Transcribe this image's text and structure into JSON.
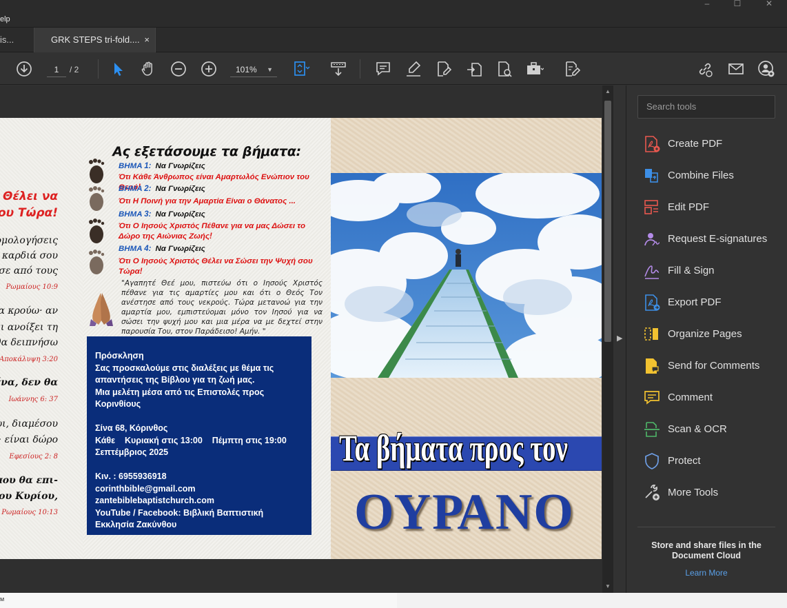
{
  "app": {
    "menu_help": "elp",
    "tabs": {
      "prev_tab": "is...",
      "active_tab": "GRK STEPS tri-fold....",
      "close": "×"
    }
  },
  "toolbar": {
    "page_current": "1",
    "page_total": "/ 2",
    "zoom": "101%",
    "icons": [
      "download-icon",
      "select-cursor-icon",
      "hand-icon",
      "zoom-out-icon",
      "zoom-in-icon",
      "fit-page-icon",
      "scroll-mode-icon",
      "comment-icon",
      "highlight-icon",
      "edit-icon",
      "export-icon",
      "organize-icon",
      "tools-bag-icon",
      "sign-icon",
      "link-icon",
      "mail-icon",
      "add-user-icon"
    ]
  },
  "document": {
    "left_column": {
      "red_heading_1": "ός Θέλει να",
      "red_heading_2": "ου Τώρα!",
      "lines_1": [
        "ομολογήσεις",
        "καρδιά σου",
        "σε από τους"
      ],
      "ref_1": "Ρωμαίους 10:9",
      "lines_2": [
        "α κρούω· αν",
        "αι ανοίξει τη",
        "θα δειπνήσω"
      ],
      "ref_2": "Αποκάλυψη 3:20",
      "lines_3": [
        "ένα, δεν θα"
      ],
      "ref_3": "Ιωάννης 6: 37",
      "lines_4": [
        "ωι, διαμέσου",
        "ς· είναι δώρο"
      ],
      "ref_4": "Εφεσίους 2: 8",
      "lines_5": [
        "ς που θα επι-",
        "α του Κυρίου,"
      ],
      "ref_5": "Ρωμαίους 10:13"
    },
    "middle_column": {
      "heading": "Ας εξετάσουμε τα βήματα:",
      "know": "Να Γνωρίζεις",
      "steps": [
        {
          "label": "ΒΗΜΑ 1:",
          "text": "Ότι Κάθε Άνθρωπος είναι Αμαρτωλός Ενώπιον του Θεού!"
        },
        {
          "label": "ΒΗΜΑ 2:",
          "text": "Ότι Η Ποινή  για την Αμαρτία Είναι ο Θάνατος ..."
        },
        {
          "label": "ΒΗΜΑ 3:",
          "text": "Ότι Ο Ιησούς Χριστός Πέθανε για να μας Δώσει το Δώρο της Αιώνιας Ζωής!"
        },
        {
          "label": "ΒΗΜΑ 4:",
          "text": "Ότι  Ο Ιησούς Χριστός Θέλει να  Σώσει  την Ψυχή σου Τώρα!"
        }
      ],
      "prayer": "\"Αγαπητέ Θεέ μου, πιστεύω ότι ο Ιησούς Χριστός πέθανε για τις αμαρτίες μου και ότι ο Θεός Τον ανέστησε από τους νεκρούς.  Τώρα μετανοώ για  την αμαρτία μου, εμπιστεύομαι μόνο τον Ιησού για να σώσει την ψυχή μου και μια μέρα να με δεχτεί στην παρουσία Του,  στον Παράδεισο!  Αμήν. \"",
      "invitation": {
        "title": "Πρόσκληση",
        "lines": [
          "Σας προσκαλούμε στις διαλέξεις με θέμα τις",
          "απαντήσεις της Βίβλου για τη ζωή μας.",
          "Μια μελέτη μέσα από τις Επιστολές προς",
          "Κορινθίους"
        ],
        "address": "Σίνα 68, Κόρινθος",
        "schedule": "Κάθε    Κυριακή στις 13:00    Πέμπτη στις 19:00",
        "month": "Σεπτέμβριος 2025",
        "phone": "Κιν. :  6955936918",
        "email": "corinthbible@gmail.com",
        "website": "zantebiblebaptistchurch.com",
        "social_1": "YouTube / Facebook: Βιβλική Βαπτιστική",
        "social_2": "Εκκλησία Ζακύνθου"
      }
    },
    "cover": {
      "line1": "Τα βήματα προς τον",
      "line2": "ΟΥΡΑΝΟ"
    }
  },
  "tools_panel": {
    "search_placeholder": "Search tools",
    "tools": [
      {
        "label": "Create PDF",
        "icon": "create-pdf-icon",
        "color": "#e8584f"
      },
      {
        "label": "Combine Files",
        "icon": "combine-files-icon",
        "color": "#3d8fe6"
      },
      {
        "label": "Edit PDF",
        "icon": "edit-pdf-icon",
        "color": "#e8584f"
      },
      {
        "label": "Request E-signatures",
        "icon": "request-esign-icon",
        "color": "#b48be8"
      },
      {
        "label": "Fill & Sign",
        "icon": "fill-sign-icon",
        "color": "#b48be8"
      },
      {
        "label": "Export PDF",
        "icon": "export-pdf-icon",
        "color": "#3d8fe6"
      },
      {
        "label": "Organize Pages",
        "icon": "organize-pages-icon",
        "color": "#f2c230"
      },
      {
        "label": "Send for Comments",
        "icon": "send-comments-icon",
        "color": "#f2c230"
      },
      {
        "label": "Comment",
        "icon": "comment-tool-icon",
        "color": "#f2c230"
      },
      {
        "label": "Scan & OCR",
        "icon": "scan-ocr-icon",
        "color": "#4fb86a"
      },
      {
        "label": "Protect",
        "icon": "protect-icon",
        "color": "#6fa0e8"
      },
      {
        "label": "More Tools",
        "icon": "more-tools-icon",
        "color": "#d0d0d0"
      }
    ],
    "promo": "Store and share files in the Document Cloud",
    "learn_more": "Learn More"
  },
  "colors": {
    "accent_blue": "#2c8ff0",
    "invitation_bg": "#0a2d7a",
    "step_red": "#d11111",
    "step_blue": "#1a56b8"
  }
}
